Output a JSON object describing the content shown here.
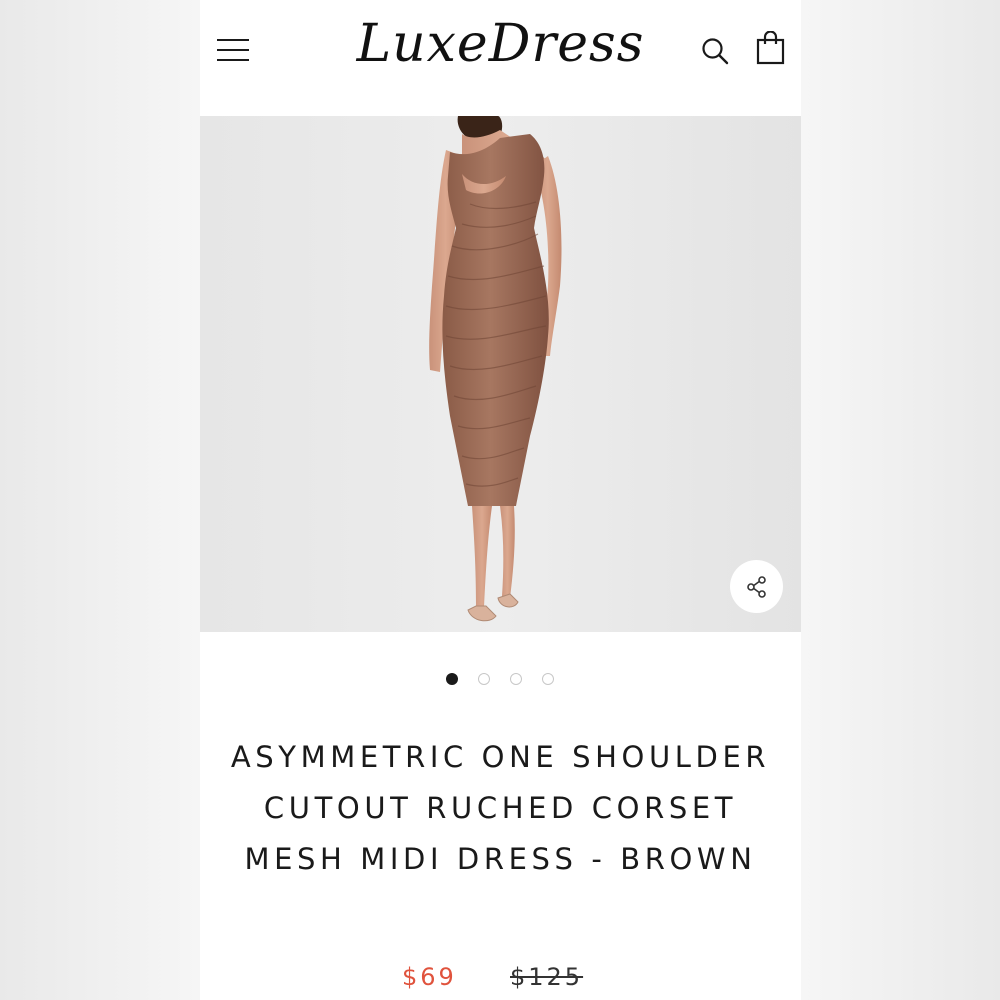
{
  "header": {
    "logo_text": "LuxeDress",
    "menu_icon": "hamburger-menu-icon",
    "search_icon": "search-icon",
    "cart_icon": "shopping-bag-icon"
  },
  "product": {
    "image_description_icon": "product-photo",
    "share_icon": "share-icon",
    "gallery": {
      "count": 4,
      "active_index": 0
    },
    "title": "ASYMMETRIC ONE SHOULDER CUTOUT RUCHED CORSET MESH MIDI DRESS - BROWN",
    "price_sale": "$69",
    "price_original": "$125"
  },
  "colors": {
    "sale_price": "#e0533d",
    "dress": "#9a6a55",
    "text": "#1a1a1a"
  }
}
